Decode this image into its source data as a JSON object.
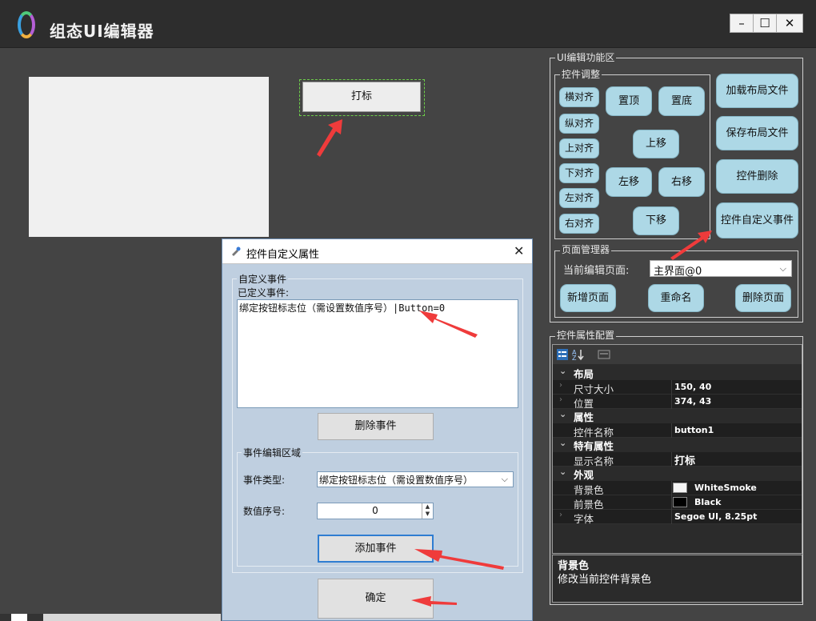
{
  "app": {
    "title": "组态UI编辑器",
    "window_controls": {
      "minimize": "–",
      "maximize": "☐",
      "close": "✕"
    }
  },
  "canvas": {
    "design_button_label": "打标"
  },
  "ui_edit_area": {
    "title": "UI编辑功能区",
    "control_adjust": {
      "title": "控件调整",
      "align_buttons": [
        "横对齐",
        "纵对齐",
        "上对齐",
        "下对齐",
        "左对齐",
        "右对齐"
      ],
      "top": "置顶",
      "bottom": "置底",
      "move_up": "上移",
      "move_left": "左移",
      "move_right": "右移",
      "move_down": "下移"
    },
    "file_buttons": {
      "load_layout": "加载布局文件",
      "save_layout": "保存布局文件",
      "delete_control": "控件删除",
      "custom_event": "控件自定义事件"
    },
    "page_manager": {
      "title": "页面管理器",
      "current_page_label": "当前编辑页面:",
      "current_page_value": "主界面@0",
      "add_page": "新增页面",
      "rename": "重命名",
      "delete_page": "删除页面"
    }
  },
  "property_config": {
    "title": "控件属性配置",
    "categories": {
      "layout": "布局",
      "attributes": "属性",
      "special": "特有属性",
      "appearance": "外观"
    },
    "props": {
      "size": {
        "label": "尺寸大小",
        "value": "150, 40"
      },
      "position": {
        "label": "位置",
        "value": "374, 43"
      },
      "name": {
        "label": "控件名称",
        "value": "button1"
      },
      "display_name": {
        "label": "显示名称",
        "value": "打标"
      },
      "back_color": {
        "label": "背景色",
        "value": "WhiteSmoke",
        "swatch": "#f5f5f5"
      },
      "fore_color": {
        "label": "前景色",
        "value": "Black",
        "swatch": "#000000"
      },
      "font": {
        "label": "字体",
        "value": "Segoe UI, 8.25pt"
      }
    },
    "help": {
      "title": "背景色",
      "description": "修改当前控件背景色"
    }
  },
  "dialog": {
    "title": "控件自定义属性",
    "custom_event_group": "自定义事件",
    "defined_events_label": "已定义事件:",
    "defined_events": [
      {
        "name": "绑定按钮标志位（需设置数值序号）",
        "suffix": "|Button=0"
      }
    ],
    "delete_event": "删除事件",
    "edit_area_group": "事件编辑区域",
    "event_type_label": "事件类型:",
    "event_type_value": "绑定按钮标志位（需设置数值序号）",
    "index_label": "数值序号:",
    "index_value": "0",
    "add_event": "添加事件",
    "confirm": "确定"
  },
  "colors": {
    "pill": "#add8e6",
    "background": "#444444",
    "dialog_bg": "#bfcfe0",
    "arrow": "#ef3b3b"
  }
}
